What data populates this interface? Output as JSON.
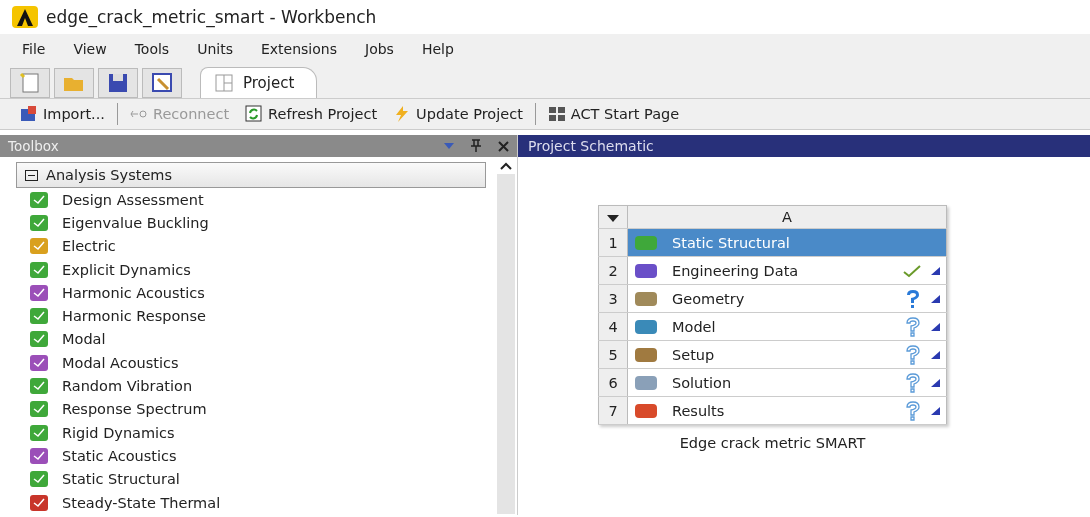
{
  "window": {
    "title": "edge_crack_metric_smart - Workbench"
  },
  "menu": [
    "File",
    "View",
    "Tools",
    "Units",
    "Extensions",
    "Jobs",
    "Help"
  ],
  "tabs": [
    {
      "label": "Project",
      "selected": true
    }
  ],
  "actions": [
    {
      "label": "Import...",
      "disabled": false
    },
    {
      "label": "Reconnect",
      "disabled": true
    },
    {
      "label": "Refresh Project",
      "disabled": false
    },
    {
      "label": "Update Project",
      "disabled": false
    },
    {
      "label": "ACT Start Page",
      "disabled": false
    }
  ],
  "toolbox": {
    "title": "Toolbox",
    "group": {
      "label": "Analysis Systems",
      "expanded": true,
      "items": [
        {
          "label": "Design Assessment",
          "color": "#3fa83a"
        },
        {
          "label": "Eigenvalue Buckling",
          "color": "#3fa83a"
        },
        {
          "label": "Electric",
          "color": "#d9a01e"
        },
        {
          "label": "Explicit Dynamics",
          "color": "#3fa83a"
        },
        {
          "label": "Harmonic Acoustics",
          "color": "#9b4fb8"
        },
        {
          "label": "Harmonic Response",
          "color": "#3fa83a"
        },
        {
          "label": "Modal",
          "color": "#3fa83a"
        },
        {
          "label": "Modal Acoustics",
          "color": "#9b4fb8"
        },
        {
          "label": "Random Vibration",
          "color": "#3fa83a"
        },
        {
          "label": "Response Spectrum",
          "color": "#3fa83a"
        },
        {
          "label": "Rigid Dynamics",
          "color": "#3fa83a"
        },
        {
          "label": "Static Acoustics",
          "color": "#9b4fb8"
        },
        {
          "label": "Static Structural",
          "color": "#3fa83a"
        },
        {
          "label": "Steady-State Thermal",
          "color": "#c8352a"
        }
      ]
    }
  },
  "schematic": {
    "title": "Project Schematic",
    "system": {
      "column": "A",
      "name": "Edge crack metric SMART",
      "rows": [
        {
          "number": "1",
          "label": "Static Structural",
          "selected": true,
          "kind": "system"
        },
        {
          "number": "2",
          "label": "Engineering Data",
          "selected": false,
          "kind": "cell",
          "up_to_date": true,
          "attention": false
        },
        {
          "number": "3",
          "label": "Geometry",
          "selected": false,
          "kind": "cell",
          "up_to_date": false,
          "attention": true
        },
        {
          "number": "4",
          "label": "Model",
          "selected": false,
          "kind": "cell",
          "up_to_date": false,
          "attention": false
        },
        {
          "number": "5",
          "label": "Setup",
          "selected": false,
          "kind": "cell",
          "up_to_date": false,
          "attention": false
        },
        {
          "number": "6",
          "label": "Solution",
          "selected": false,
          "kind": "cell",
          "up_to_date": false,
          "attention": false
        },
        {
          "number": "7",
          "label": "Results",
          "selected": false,
          "kind": "cell",
          "up_to_date": false,
          "attention": false
        }
      ]
    }
  }
}
